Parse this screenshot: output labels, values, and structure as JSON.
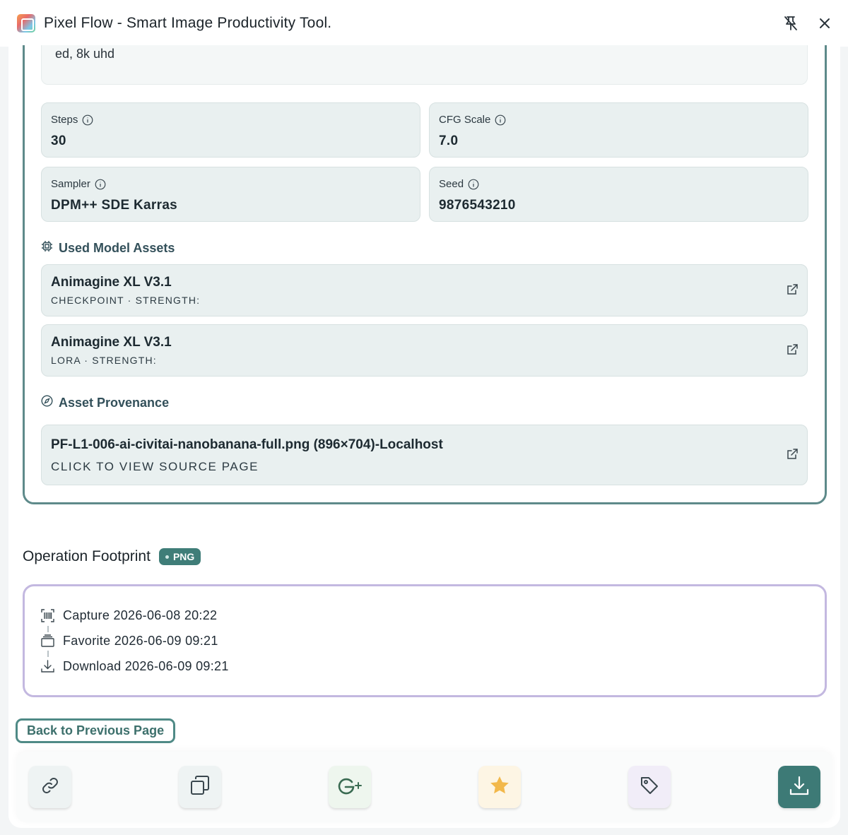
{
  "window": {
    "title": "Pixel Flow - Smart Image Productivity Tool."
  },
  "prompt": {
    "text_tail": "ed, 8k uhd"
  },
  "params": {
    "steps": {
      "label": "Steps",
      "value": "30"
    },
    "cfg": {
      "label": "CFG Scale",
      "value": "7.0"
    },
    "sampler": {
      "label": "Sampler",
      "value": "DPM++ SDE Karras"
    },
    "seed": {
      "label": "Seed",
      "value": "9876543210"
    }
  },
  "assets": {
    "section_title": "Used Model Assets",
    "items": [
      {
        "name": "Animagine XL V3.1",
        "meta": "CHECKPOINT · STRENGTH:"
      },
      {
        "name": "Animagine XL V3.1",
        "meta": "LORA · STRENGTH:"
      }
    ]
  },
  "provenance": {
    "section_title": "Asset Provenance",
    "file": "PF-L1-006-ai-civitai-nanobanana-full.png (896×704)-Localhost",
    "action": "CLICK TO VIEW SOURCE PAGE"
  },
  "operation": {
    "title": "Operation Footprint",
    "badge": "PNG",
    "events": [
      {
        "label": "Capture 2026-06-08 20:22",
        "icon": "barcode-scan-icon"
      },
      {
        "label": "Favorite 2026-06-09 09:21",
        "icon": "archive-box-icon"
      },
      {
        "label": "Download 2026-06-09 09:21",
        "icon": "download-icon"
      }
    ]
  },
  "nav": {
    "back_label": "Back to Previous Page"
  },
  "toolbar": {
    "tools": [
      {
        "name": "link",
        "icon": "link-icon",
        "bg": "#eef3f3"
      },
      {
        "name": "copy",
        "icon": "copy-icon",
        "bg": "#eef3f3"
      },
      {
        "name": "google-plus",
        "icon": "google-plus-icon",
        "bg": "#eef6ee"
      },
      {
        "name": "favorite",
        "icon": "star-icon",
        "bg": "#fdf5e4"
      },
      {
        "name": "tag",
        "icon": "tag-icon",
        "bg": "#f1edf8"
      },
      {
        "name": "download",
        "icon": "download-icon",
        "bg": "#3d7a76"
      }
    ]
  },
  "colors": {
    "accent_teal": "#3f7d78",
    "card_border_teal": "#5e8a8a",
    "card_border_purple": "#c3b8e0",
    "star": "#f2b84b"
  }
}
